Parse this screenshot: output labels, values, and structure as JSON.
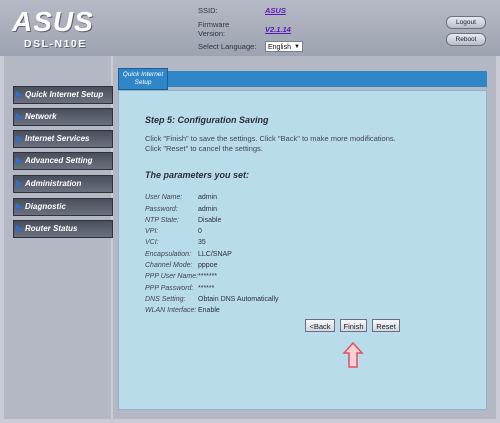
{
  "header": {
    "brand": "ASUS",
    "model": "DSL-N10E",
    "ssid_label": "SSID:",
    "ssid_value": "ASUS",
    "firmware_label_line1": "Firmware",
    "firmware_label_line2": "Version:",
    "firmware_value": "V2.1.14",
    "language_label": "Select Language:",
    "language_value": "English",
    "logout_label": "Logout",
    "reboot_label": "Reboot"
  },
  "sidebar": {
    "items": [
      {
        "label": "Quick Internet Setup"
      },
      {
        "label": "Network"
      },
      {
        "label": "Internet Services"
      },
      {
        "label": "Advanced Setting"
      },
      {
        "label": "Administration"
      },
      {
        "label": "Diagnostic"
      },
      {
        "label": "Router Status"
      }
    ]
  },
  "tabs": {
    "active_line1": "Quick Internet",
    "active_line2": "Setup"
  },
  "main": {
    "step_title": "Step 5: Configuration Saving",
    "step_desc": "Click \"Finish\" to save the settings. Click \"Back\" to make more modifications. Click \"Reset\" to cancel the settings.",
    "params_title": "The parameters you set:",
    "params": [
      {
        "label": "User Name:",
        "value": "admin"
      },
      {
        "label": "Password:",
        "value": "admin"
      },
      {
        "label": "NTP State:",
        "value": "Disable"
      },
      {
        "label": "VPI:",
        "value": "0"
      },
      {
        "label": "VCI:",
        "value": "35"
      },
      {
        "label": "Encapsulation:",
        "value": "LLC/SNAP"
      },
      {
        "label": "Channel Mode:",
        "value": "pppoe"
      },
      {
        "label": "PPP User Name:",
        "value": "*******"
      },
      {
        "label": "PPP Password:",
        "value": "******"
      },
      {
        "label": "DNS Setting:",
        "value": "Obtain DNS Automatically"
      },
      {
        "label": "WLAN Interface:",
        "value": "Enable"
      }
    ],
    "back_label": "<Back",
    "finish_label": "Finish",
    "reset_label": "Reset"
  },
  "colors": {
    "accent_tab": "#2f86c6",
    "panel_bg": "#b9dcea",
    "menu_bg": "#4a4f5c",
    "arrow_annotation": "#e05060"
  }
}
